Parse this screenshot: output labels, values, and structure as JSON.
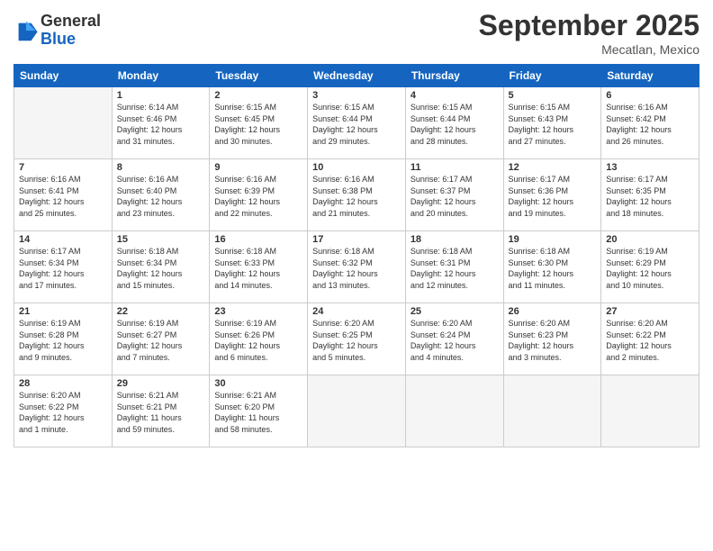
{
  "logo": {
    "general": "General",
    "blue": "Blue"
  },
  "title": "September 2025",
  "subtitle": "Mecatlan, Mexico",
  "weekdays": [
    "Sunday",
    "Monday",
    "Tuesday",
    "Wednesday",
    "Thursday",
    "Friday",
    "Saturday"
  ],
  "weeks": [
    [
      {
        "day": "",
        "info": ""
      },
      {
        "day": "1",
        "info": "Sunrise: 6:14 AM\nSunset: 6:46 PM\nDaylight: 12 hours\nand 31 minutes."
      },
      {
        "day": "2",
        "info": "Sunrise: 6:15 AM\nSunset: 6:45 PM\nDaylight: 12 hours\nand 30 minutes."
      },
      {
        "day": "3",
        "info": "Sunrise: 6:15 AM\nSunset: 6:44 PM\nDaylight: 12 hours\nand 29 minutes."
      },
      {
        "day": "4",
        "info": "Sunrise: 6:15 AM\nSunset: 6:44 PM\nDaylight: 12 hours\nand 28 minutes."
      },
      {
        "day": "5",
        "info": "Sunrise: 6:15 AM\nSunset: 6:43 PM\nDaylight: 12 hours\nand 27 minutes."
      },
      {
        "day": "6",
        "info": "Sunrise: 6:16 AM\nSunset: 6:42 PM\nDaylight: 12 hours\nand 26 minutes."
      }
    ],
    [
      {
        "day": "7",
        "info": "Sunrise: 6:16 AM\nSunset: 6:41 PM\nDaylight: 12 hours\nand 25 minutes."
      },
      {
        "day": "8",
        "info": "Sunrise: 6:16 AM\nSunset: 6:40 PM\nDaylight: 12 hours\nand 23 minutes."
      },
      {
        "day": "9",
        "info": "Sunrise: 6:16 AM\nSunset: 6:39 PM\nDaylight: 12 hours\nand 22 minutes."
      },
      {
        "day": "10",
        "info": "Sunrise: 6:16 AM\nSunset: 6:38 PM\nDaylight: 12 hours\nand 21 minutes."
      },
      {
        "day": "11",
        "info": "Sunrise: 6:17 AM\nSunset: 6:37 PM\nDaylight: 12 hours\nand 20 minutes."
      },
      {
        "day": "12",
        "info": "Sunrise: 6:17 AM\nSunset: 6:36 PM\nDaylight: 12 hours\nand 19 minutes."
      },
      {
        "day": "13",
        "info": "Sunrise: 6:17 AM\nSunset: 6:35 PM\nDaylight: 12 hours\nand 18 minutes."
      }
    ],
    [
      {
        "day": "14",
        "info": "Sunrise: 6:17 AM\nSunset: 6:34 PM\nDaylight: 12 hours\nand 17 minutes."
      },
      {
        "day": "15",
        "info": "Sunrise: 6:18 AM\nSunset: 6:34 PM\nDaylight: 12 hours\nand 15 minutes."
      },
      {
        "day": "16",
        "info": "Sunrise: 6:18 AM\nSunset: 6:33 PM\nDaylight: 12 hours\nand 14 minutes."
      },
      {
        "day": "17",
        "info": "Sunrise: 6:18 AM\nSunset: 6:32 PM\nDaylight: 12 hours\nand 13 minutes."
      },
      {
        "day": "18",
        "info": "Sunrise: 6:18 AM\nSunset: 6:31 PM\nDaylight: 12 hours\nand 12 minutes."
      },
      {
        "day": "19",
        "info": "Sunrise: 6:18 AM\nSunset: 6:30 PM\nDaylight: 12 hours\nand 11 minutes."
      },
      {
        "day": "20",
        "info": "Sunrise: 6:19 AM\nSunset: 6:29 PM\nDaylight: 12 hours\nand 10 minutes."
      }
    ],
    [
      {
        "day": "21",
        "info": "Sunrise: 6:19 AM\nSunset: 6:28 PM\nDaylight: 12 hours\nand 9 minutes."
      },
      {
        "day": "22",
        "info": "Sunrise: 6:19 AM\nSunset: 6:27 PM\nDaylight: 12 hours\nand 7 minutes."
      },
      {
        "day": "23",
        "info": "Sunrise: 6:19 AM\nSunset: 6:26 PM\nDaylight: 12 hours\nand 6 minutes."
      },
      {
        "day": "24",
        "info": "Sunrise: 6:20 AM\nSunset: 6:25 PM\nDaylight: 12 hours\nand 5 minutes."
      },
      {
        "day": "25",
        "info": "Sunrise: 6:20 AM\nSunset: 6:24 PM\nDaylight: 12 hours\nand 4 minutes."
      },
      {
        "day": "26",
        "info": "Sunrise: 6:20 AM\nSunset: 6:23 PM\nDaylight: 12 hours\nand 3 minutes."
      },
      {
        "day": "27",
        "info": "Sunrise: 6:20 AM\nSunset: 6:22 PM\nDaylight: 12 hours\nand 2 minutes."
      }
    ],
    [
      {
        "day": "28",
        "info": "Sunrise: 6:20 AM\nSunset: 6:22 PM\nDaylight: 12 hours\nand 1 minute."
      },
      {
        "day": "29",
        "info": "Sunrise: 6:21 AM\nSunset: 6:21 PM\nDaylight: 11 hours\nand 59 minutes."
      },
      {
        "day": "30",
        "info": "Sunrise: 6:21 AM\nSunset: 6:20 PM\nDaylight: 11 hours\nand 58 minutes."
      },
      {
        "day": "",
        "info": ""
      },
      {
        "day": "",
        "info": ""
      },
      {
        "day": "",
        "info": ""
      },
      {
        "day": "",
        "info": ""
      }
    ]
  ]
}
